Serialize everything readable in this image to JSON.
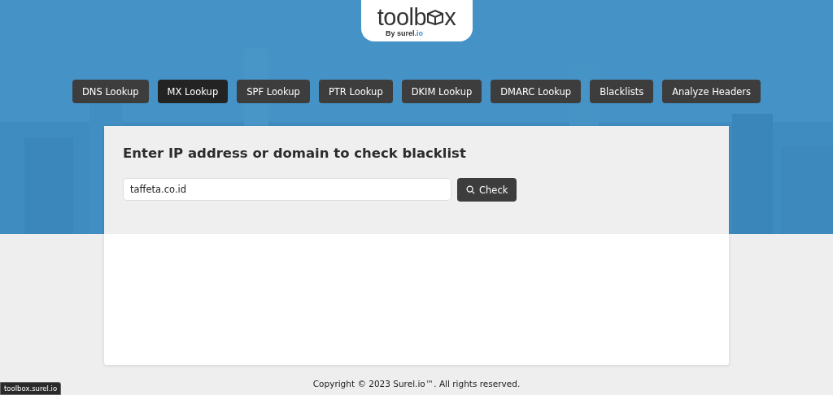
{
  "logo": {
    "text_before": "toolb",
    "text_after": "x",
    "byline": "By surel",
    "byline_accent": ".io"
  },
  "nav": [
    {
      "label": "DNS Lookup",
      "selected": false
    },
    {
      "label": "MX Lookup",
      "selected": true
    },
    {
      "label": "SPF Lookup",
      "selected": false
    },
    {
      "label": "PTR Lookup",
      "selected": false
    },
    {
      "label": "DKIM Lookup",
      "selected": false
    },
    {
      "label": "DMARC Lookup",
      "selected": false
    },
    {
      "label": "Blacklists",
      "selected": false
    },
    {
      "label": "Analyze Headers",
      "selected": false
    }
  ],
  "form": {
    "heading": "Enter IP address or domain to check blacklist",
    "value": "taffeta.co.id",
    "button": "Check"
  },
  "footer": "Copyright © 2023 Surel.io™. All rights reserved.",
  "status_url": "toolbox.surel.io"
}
